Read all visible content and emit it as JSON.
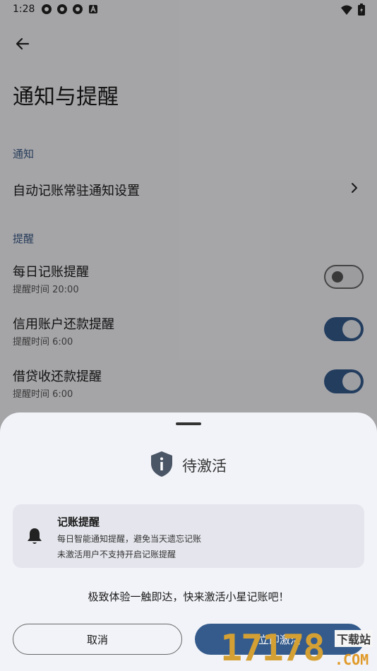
{
  "status_bar": {
    "time": "1:28"
  },
  "header": {
    "title": "通知与提醒"
  },
  "sections": {
    "notify": {
      "title": "通知",
      "item_label": "自动记账常驻通知设置"
    },
    "remind": {
      "title": "提醒",
      "items": [
        {
          "label": "每日记账提醒",
          "sub": "提醒时间 20:00",
          "enabled": false
        },
        {
          "label": "信用账户还款提醒",
          "sub": "提醒时间 6:00",
          "enabled": true
        },
        {
          "label": "借贷收还款提醒",
          "sub": "提醒时间 6:00",
          "enabled": true
        }
      ]
    }
  },
  "sheet": {
    "title": "待激活",
    "card": {
      "title": "记账提醒",
      "line1": "每日智能通知提醒，避免当天遗忘记账",
      "line2": "未激活用户不支持开启记账提醒"
    },
    "promo": "极致体验一触即达，快来激活小星记账吧！",
    "cancel_label": "取消",
    "activate_label": "立即激活"
  },
  "watermark": {
    "digits": "17178",
    "top": "下载站",
    "bottom": ".COM"
  },
  "colors": {
    "accent": "#345b8c",
    "section": "#3c5a85",
    "sheet_bg": "#f2f3f8"
  }
}
